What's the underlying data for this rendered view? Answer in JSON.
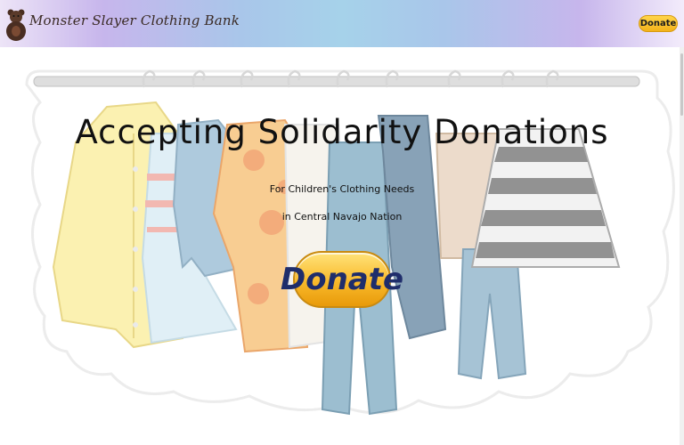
{
  "header": {
    "site_title": "Monster Slayer Clothing Bank",
    "donate_label": "Donate"
  },
  "hero": {
    "title": "Accepting Solidarity Donations",
    "subtitle_line1": "For Children's Clothing Needs",
    "subtitle_line2": "in Central Navajo Nation",
    "donate_label": "Donate"
  },
  "colors": {
    "header_gradient": [
      "#ede4f7",
      "#a6d2ea",
      "#f3ecfb"
    ],
    "donate_button": "#f9b92a",
    "donate_text": "#1f2d6b"
  },
  "icons": [
    "bear-logo-icon"
  ]
}
